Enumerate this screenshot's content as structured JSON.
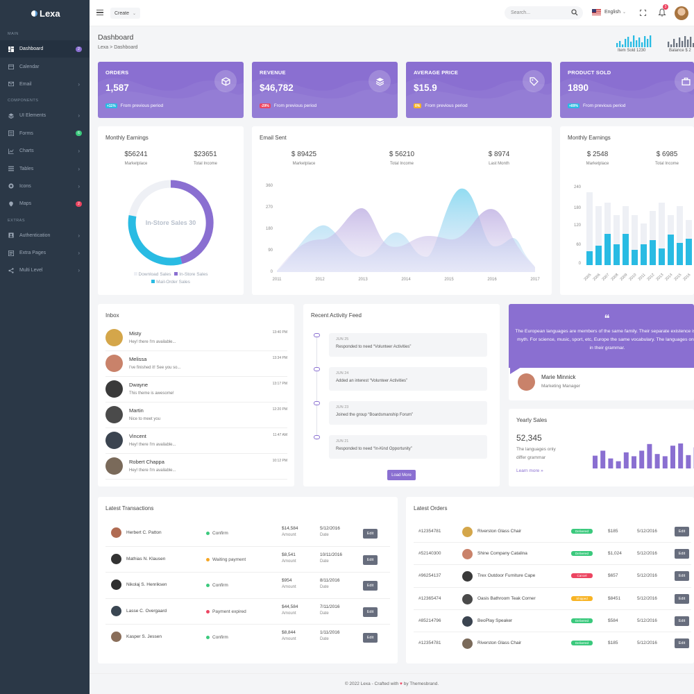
{
  "brand": {
    "name": "Lexa"
  },
  "sidebar": {
    "sections": [
      {
        "title": "MAIN"
      },
      {
        "title": "COMPONENTS"
      },
      {
        "title": "EXTRAS"
      }
    ],
    "items": [
      {
        "label": "Dashboard",
        "icon": "dashboard-icon",
        "badge": "2"
      },
      {
        "label": "Calendar",
        "icon": "calendar-icon"
      },
      {
        "label": "Email",
        "icon": "email-icon"
      },
      {
        "label": "UI Elements",
        "icon": "layers-icon"
      },
      {
        "label": "Forms",
        "icon": "forms-icon",
        "badge": "6"
      },
      {
        "label": "Charts",
        "icon": "chart-icon"
      },
      {
        "label": "Tables",
        "icon": "table-icon"
      },
      {
        "label": "Icons",
        "icon": "target-icon"
      },
      {
        "label": "Maps",
        "icon": "map-pin-icon",
        "badge": "2"
      },
      {
        "label": "Authentication",
        "icon": "user-icon"
      },
      {
        "label": "Extra Pages",
        "icon": "pages-icon"
      },
      {
        "label": "Multi Level",
        "icon": "share-icon"
      }
    ]
  },
  "topbar": {
    "create_label": "Create",
    "search_placeholder": "Search...",
    "language": "English",
    "notification_count": "3"
  },
  "page": {
    "title": "Dashboard",
    "breadcrumb": [
      "Lexa",
      "Dashboard"
    ],
    "mini_stats": [
      {
        "label": "Item Sold 1230"
      },
      {
        "label": "Balance $ 2"
      }
    ]
  },
  "kpis": [
    {
      "label": "ORDERS",
      "value": "1,587",
      "change": "+11%",
      "note": "From previous period",
      "icon": "cube-icon"
    },
    {
      "label": "REVENUE",
      "value": "$46,782",
      "change": "-29%",
      "note": "From previous period",
      "icon": "layers-icon"
    },
    {
      "label": "AVERAGE PRICE",
      "value": "$15.9",
      "change": "0%",
      "note": "From previous period",
      "icon": "tag-icon"
    },
    {
      "label": "PRODUCT SOLD",
      "value": "1890",
      "change": "+89%",
      "note": "From previous period",
      "icon": "briefcase-icon"
    }
  ],
  "earnings_left": {
    "title": "Monthly Earnings",
    "stats": [
      {
        "value": "$56241",
        "label": "Marketplace"
      },
      {
        "value": "$23651",
        "label": "Total Income"
      }
    ],
    "donut_center": "In-Store Sales 30",
    "legend": [
      "Download Sales",
      "In-Store Sales",
      "Mail-Order Sales"
    ]
  },
  "email_sent": {
    "title": "Email Sent",
    "stats": [
      {
        "value": "$ 89425",
        "label": "Marketplace"
      },
      {
        "value": "$ 56210",
        "label": "Total Income"
      },
      {
        "value": "$ 8974",
        "label": "Last Month"
      }
    ],
    "y_ticks": [
      "360",
      "270",
      "180",
      "90",
      "0"
    ],
    "x_ticks": [
      "2011",
      "2012",
      "2013",
      "2014",
      "2015",
      "2016",
      "2017"
    ]
  },
  "earnings_right": {
    "title": "Monthly Earnings",
    "stats": [
      {
        "value": "$ 2548",
        "label": "Marketplace"
      },
      {
        "value": "$ 6985",
        "label": "Total Income"
      }
    ],
    "y_ticks": [
      "240",
      "180",
      "120",
      "60",
      "0"
    ],
    "x_ticks": [
      "2005",
      "2006",
      "2007",
      "2008",
      "2009",
      "2010",
      "2011",
      "2012",
      "2013",
      "2014",
      "2015",
      "2016",
      "2017",
      "2018"
    ]
  },
  "inbox": {
    "title": "Inbox",
    "items": [
      {
        "name": "Misty",
        "message": "Hey! there I'm available...",
        "time": "13:40 PM",
        "avatar_color": "#d4a64a"
      },
      {
        "name": "Melissa",
        "message": "I've finished it! See you so...",
        "time": "13:34 PM",
        "avatar_color": "#c9826a"
      },
      {
        "name": "Dwayne",
        "message": "This theme is awesome!",
        "time": "13:17 PM",
        "avatar_color": "#3a3a3a"
      },
      {
        "name": "Martin",
        "message": "Nice to meet you",
        "time": "12:20 PM",
        "avatar_color": "#4a4a4a"
      },
      {
        "name": "Vincent",
        "message": "Hey! there I'm available...",
        "time": "11:47 AM",
        "avatar_color": "#3b4450"
      },
      {
        "name": "Robert Chappa",
        "message": "Hey! there I'm available...",
        "time": "10:12 PM",
        "avatar_color": "#7a6a5a"
      }
    ]
  },
  "activity": {
    "title": "Recent Activity Feed",
    "items": [
      {
        "date": "JUN 25",
        "text": "Responded to need “Volunteer Activities”"
      },
      {
        "date": "JUN 24",
        "text": "Added an interest “Volunteer Activities”"
      },
      {
        "date": "JUN 23",
        "text": "Joined the group “Boardsmanship Forum”"
      },
      {
        "date": "JUN 21",
        "text": "Responded to need “In-Kind Opportunity”"
      }
    ],
    "load_more": "Load More"
  },
  "testimonial": {
    "quote_mark": "❝",
    "text": "The European languages are members of the same family. Their separate existence is a myth. For science, music, sport, etc, Europe the same vocabulary. The languages only in their grammar.",
    "name": "Marie Minnick",
    "role": "Marketing Manager"
  },
  "yearly_sales": {
    "title": "Yearly Sales",
    "value": "52,345",
    "desc_line1": "The languages only",
    "desc_line2": "differ grammar",
    "link": "Learn more",
    "bars": [
      23,
      32,
      18,
      13,
      29,
      22,
      32,
      44,
      26,
      22,
      41,
      45,
      24,
      38,
      43,
      26,
      40
    ]
  },
  "transactions": {
    "title": "Latest Transactions",
    "amount_label": "Amount",
    "date_label": "Date",
    "edit_label": "Edit",
    "rows": [
      {
        "name": "Herbert C. Patton",
        "status": "Confirm",
        "status_color": "#3bc97d",
        "amount": "$14,584",
        "date": "5/12/2016",
        "avatar_color": "#b06b52"
      },
      {
        "name": "Mathias N. Klausen",
        "status": "Waiting payment",
        "status_color": "#f5a623",
        "amount": "$8,541",
        "date": "10/11/2016",
        "avatar_color": "#333"
      },
      {
        "name": "Nikolaj S. Henriksen",
        "status": "Confirm",
        "status_color": "#3bc97d",
        "amount": "$954",
        "date": "8/11/2016",
        "avatar_color": "#2e2e2e"
      },
      {
        "name": "Lasse C. Overgaard",
        "status": "Payment expired",
        "status_color": "#ec4561",
        "amount": "$44,584",
        "date": "7/11/2016",
        "avatar_color": "#3a4652"
      },
      {
        "name": "Kasper S. Jessen",
        "status": "Confirm",
        "status_color": "#3bc97d",
        "amount": "$8,844",
        "date": "1/11/2016",
        "avatar_color": "#8a6e5a"
      }
    ]
  },
  "orders": {
    "title": "Latest Orders",
    "edit_label": "Edit",
    "rows": [
      {
        "id": "#12354781",
        "product": "Riverston Glass Chair",
        "status": "Delivered",
        "status_color": "#3bc97d",
        "price": "$185",
        "date": "5/12/2016",
        "avatar_color": "#d4a64a"
      },
      {
        "id": "#52140300",
        "product": "Shine Company Catalina",
        "status": "Delivered",
        "status_color": "#3bc97d",
        "price": "$1,024",
        "date": "5/12/2016",
        "avatar_color": "#c9826a"
      },
      {
        "id": "#96254137",
        "product": "Trex Outdoor Furniture Cape",
        "status": "Cancel",
        "status_color": "#ec4561",
        "price": "$657",
        "date": "5/12/2016",
        "avatar_color": "#3a3a3a"
      },
      {
        "id": "#12365474",
        "product": "Oasis Bathroom Teak Corner",
        "status": "Shipped",
        "status_color": "#f8b425",
        "price": "$8451",
        "date": "5/12/2016",
        "avatar_color": "#4a4a4a"
      },
      {
        "id": "#85214796",
        "product": "BeoPlay Speaker",
        "status": "Delivered",
        "status_color": "#3bc97d",
        "price": "$584",
        "date": "5/12/2016",
        "avatar_color": "#3b4450"
      },
      {
        "id": "#12354781",
        "product": "Riverston Glass Chair",
        "status": "Delivered",
        "status_color": "#3bc97d",
        "price": "$185",
        "date": "5/12/2016",
        "avatar_color": "#7a6a5a"
      }
    ]
  },
  "footer": {
    "text_before": "© 2022 Lexa - Crafted with",
    "heart": "♥",
    "text_after": "by Themesbrand."
  },
  "colors": {
    "primary": "#8a6fd1",
    "sidebar": "#2b3847",
    "info": "#29bbe3",
    "success": "#3bc97d",
    "danger": "#ec4561",
    "warning": "#f8b425"
  }
}
